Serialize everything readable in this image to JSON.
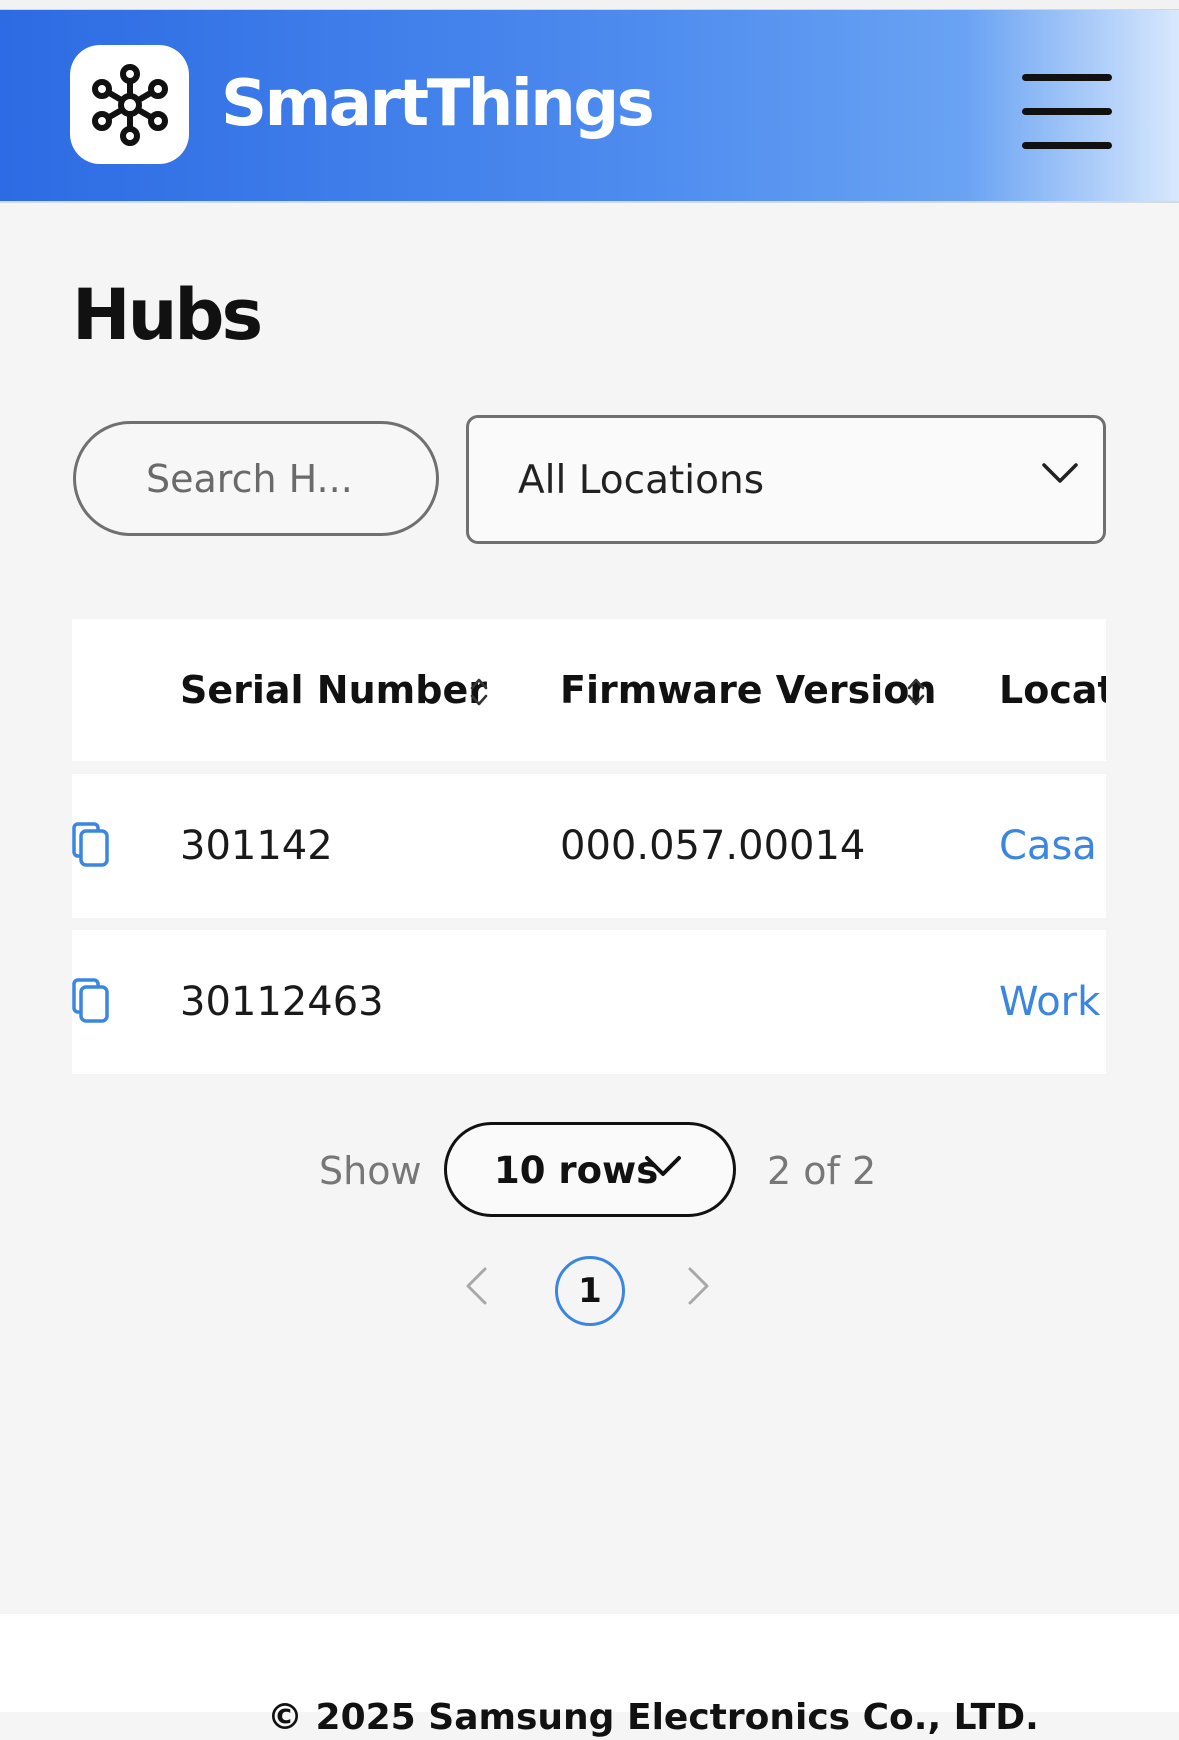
{
  "header": {
    "brand": "SmartThings",
    "logo_icon": "smartthings-logo-icon",
    "menu_icon": "hamburger-menu-icon",
    "gradient_start": "#2c6be3",
    "gradient_end": "#d8e8fd"
  },
  "page": {
    "title": "Hubs"
  },
  "filters": {
    "search_placeholder": "Search H...",
    "location_selected": "All Locations"
  },
  "table": {
    "columns": [
      "Serial Number",
      "Firmware Version",
      "Locati"
    ],
    "rows": [
      {
        "serial": "301142",
        "firmware": "000.057.00014",
        "location": "Casa"
      },
      {
        "serial": "30112463",
        "firmware": "",
        "location": "Work"
      }
    ],
    "link_color": "#3b86e0"
  },
  "pagination": {
    "show_label": "Show",
    "rows_per_page": "10 rows",
    "count_text": "2 of 2",
    "current_page": "1",
    "prev_icon": "chevron-left-icon",
    "next_icon": "chevron-right-icon"
  },
  "footer": {
    "copyright": "© 2025 Samsung Electronics Co., LTD."
  }
}
